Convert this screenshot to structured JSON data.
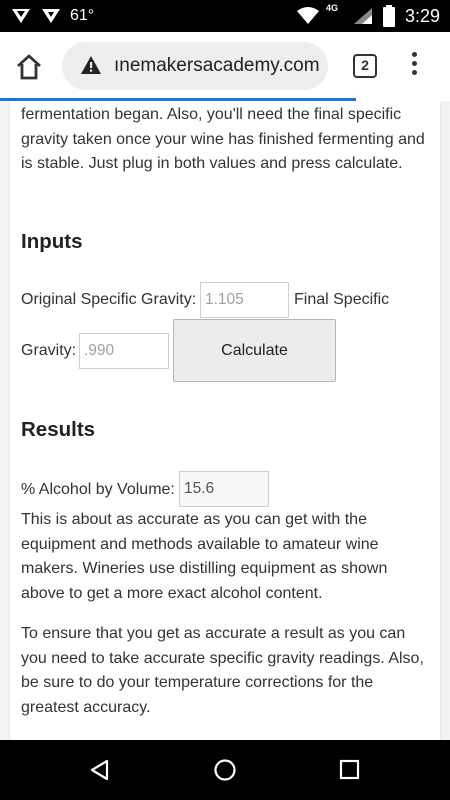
{
  "status_bar": {
    "temperature": "61°",
    "network": "4G",
    "time": "3:29"
  },
  "browser": {
    "url": "ınemakersacademy.com",
    "tab_count": "2"
  },
  "content": {
    "intro_paragraph": "fermentation began. Also, you'll need the final specific gravity taken once your wine has finished fermenting and is stable. Just plug in both values and press calculate.",
    "inputs_heading": "Inputs",
    "original_gravity_label": "Original Specific Gravity:",
    "original_gravity_placeholder": "1.105",
    "final_gravity_label_part1": "Final Specific",
    "final_gravity_label_part2": "Gravity:",
    "final_gravity_placeholder": ".990",
    "calculate_label": "Calculate",
    "results_heading": "Results",
    "alcohol_label": "% Alcohol by Volume:",
    "alcohol_value": "15.6",
    "accuracy_paragraph": "This is about as accurate as you can get with the equipment and methods available to amateur wine makers. Wineries use distilling equipment as shown above to get a more exact alcohol content.",
    "tip_paragraph": "To ensure that you get as accurate a result as you can you need to take accurate specific gravity readings. Also, be sure to do your temperature corrections for the greatest accuracy."
  },
  "colors": {
    "progress": "#1a73e8",
    "page_bg": "#f3f3f3",
    "card_bg": "#ffffff"
  },
  "icons": [
    "shield-icon",
    "android-icon",
    "wifi-icon",
    "signal-icon",
    "battery-icon",
    "home-icon",
    "warning-icon",
    "tabs-icon",
    "menu-icon",
    "back-icon",
    "home-circle-icon",
    "recents-icon"
  ]
}
